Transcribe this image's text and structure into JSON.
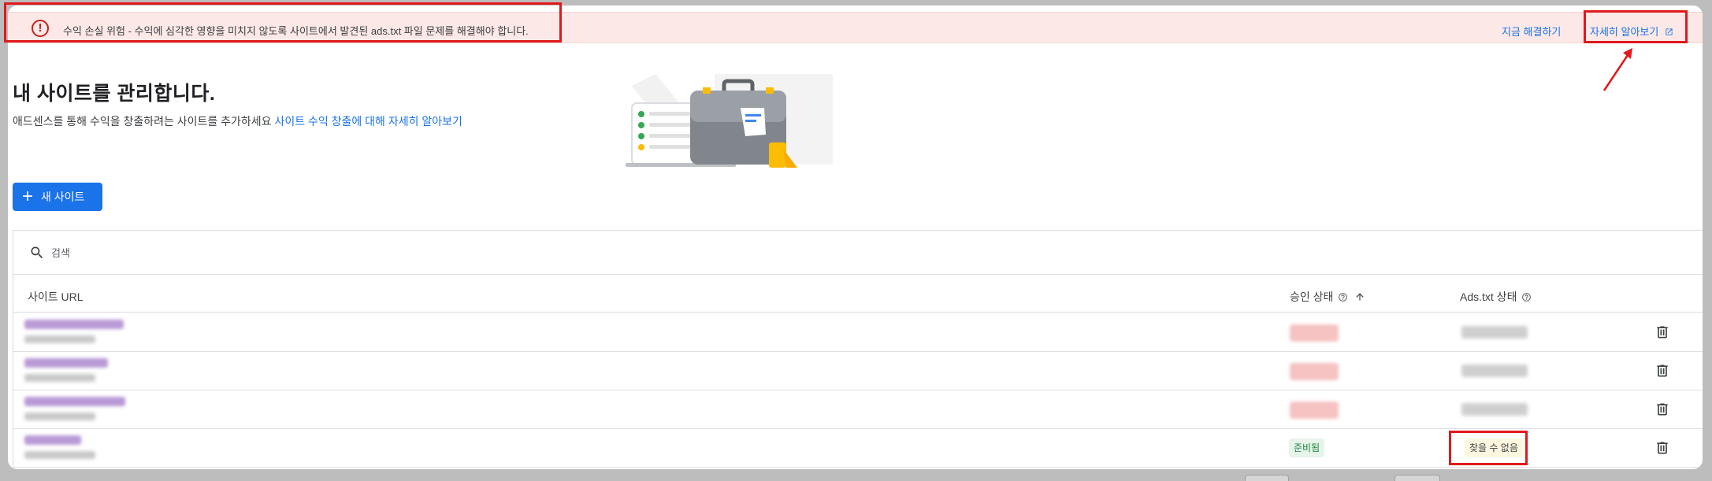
{
  "alert": {
    "icon": "error-icon",
    "message": "수익 손실 위험 - 수익에 심각한 영향을 미치지 않도록 사이트에서 발견된 ads.txt 파일 문제를 해결해야 합니다.",
    "fix_label": "지금 해결하기",
    "learn_label": "자세히 알아보기",
    "learn_icon": "open-in-new-icon"
  },
  "header": {
    "title": "내 사이트를 관리합니다.",
    "subtitle": "애드센스를 통해 수익을 창출하려는 사이트를 추가하세요",
    "subtitle_link": "사이트 수익 창출에 대해 자세히 알아보기"
  },
  "new_site_button": {
    "icon": "plus-icon",
    "label": "새 사이트"
  },
  "search": {
    "placeholder": "검색",
    "icon": "search-icon"
  },
  "table": {
    "columns": {
      "url": "사이트 URL",
      "approval": "승인 상태",
      "ads_txt": "Ads.txt 상태"
    },
    "rows": [
      {
        "approval_status": "",
        "ads_status": ""
      },
      {
        "approval_status": "",
        "ads_status": ""
      },
      {
        "approval_status": "",
        "ads_status": ""
      },
      {
        "approval_status": "준비됨",
        "ads_status": "찾을 수 없음"
      }
    ]
  },
  "colors": {
    "accent": "#1a73e8",
    "alert_bg": "#fce8e6",
    "error": "#c5221f",
    "annotation": "#e0191c",
    "ready_bg": "#e6f4ea",
    "ready_text": "#188038",
    "notfound_bg": "#fef7e0"
  }
}
